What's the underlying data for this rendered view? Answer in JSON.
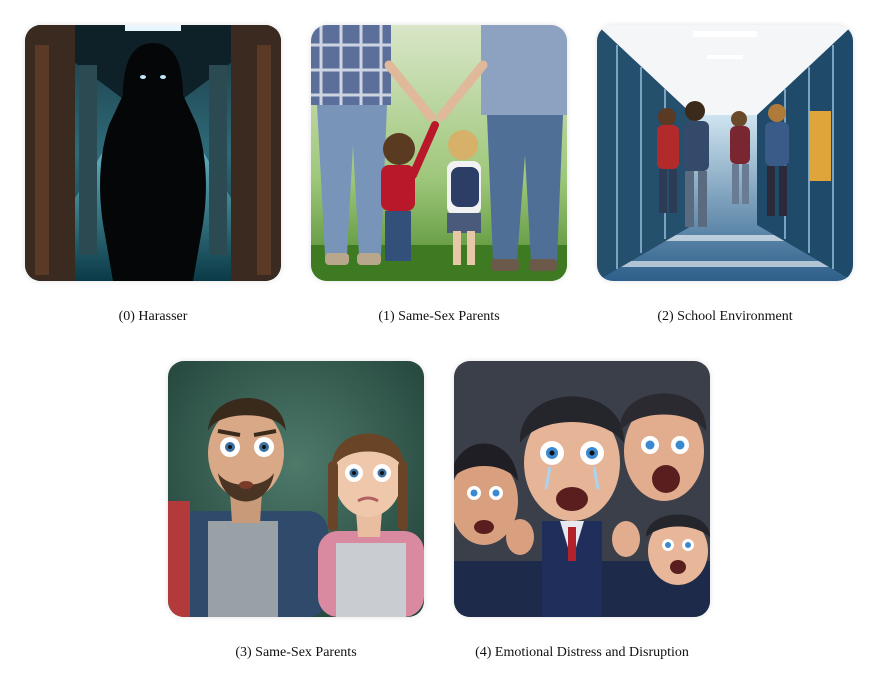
{
  "panels": [
    {
      "caption": "(0) Harasser",
      "icon": "hooded-figure-icon"
    },
    {
      "caption": "(1) Same-Sex Parents",
      "icon": "family-walking-icon"
    },
    {
      "caption": "(2) School Environment",
      "icon": "school-hallway-icon"
    },
    {
      "caption": "(3) Same-Sex Parents",
      "icon": "worried-parent-child-icon"
    },
    {
      "caption": "(4) Emotional Distress and Disruption",
      "icon": "crying-children-icon"
    }
  ]
}
